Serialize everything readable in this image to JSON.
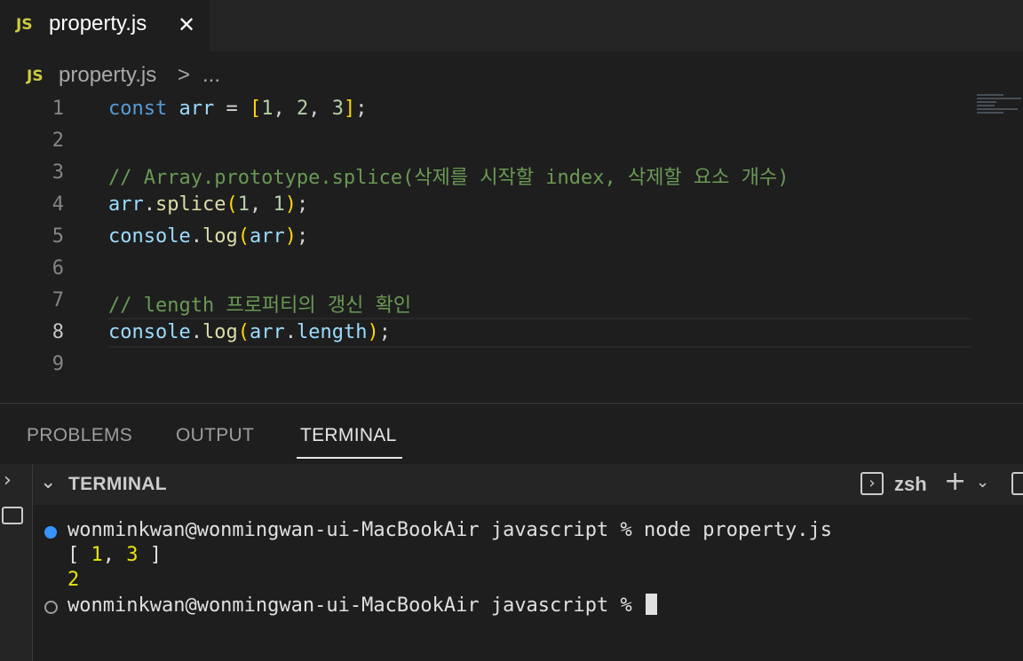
{
  "tab": {
    "lang_badge": "JS",
    "file_name": "property.js",
    "close_glyph": "✕"
  },
  "breadcrumb": {
    "lang_badge": "JS",
    "file_name": "property.js",
    "separator": ">",
    "more": "..."
  },
  "editor": {
    "active_line": 8,
    "line_numbers": [
      "1",
      "2",
      "3",
      "4",
      "5",
      "6",
      "7",
      "8",
      "9"
    ],
    "comment_line3": "// Array.prototype.splice(삭제를 시작할 index, 삭제할 요소 개수)",
    "comment_line7": "// length 프로퍼티의 갱신 확인"
  },
  "panel": {
    "tabs": [
      "PROBLEMS",
      "OUTPUT",
      "TERMINAL"
    ],
    "active_tab": "TERMINAL",
    "terminal_title": "TERMINAL",
    "shell_name": "zsh"
  },
  "terminal": {
    "line1": "wonminkwan@wonmingwan-ui-MacBookAir javascript % node property.js",
    "out_open": "[ ",
    "out_v1": "1",
    "out_comma": ", ",
    "out_v2": "3",
    "out_close": " ]",
    "out_length": "2",
    "prompt": "wonminkwan@wonmingwan-ui-MacBookAir javascript % "
  },
  "colors": {
    "accent": "#3794ff",
    "keyword": "#569cd6",
    "variable": "#9cdcfe",
    "number": "#b5cea8",
    "function": "#dcdcaa",
    "comment": "#6a9955",
    "bracket": "#ffd700"
  }
}
